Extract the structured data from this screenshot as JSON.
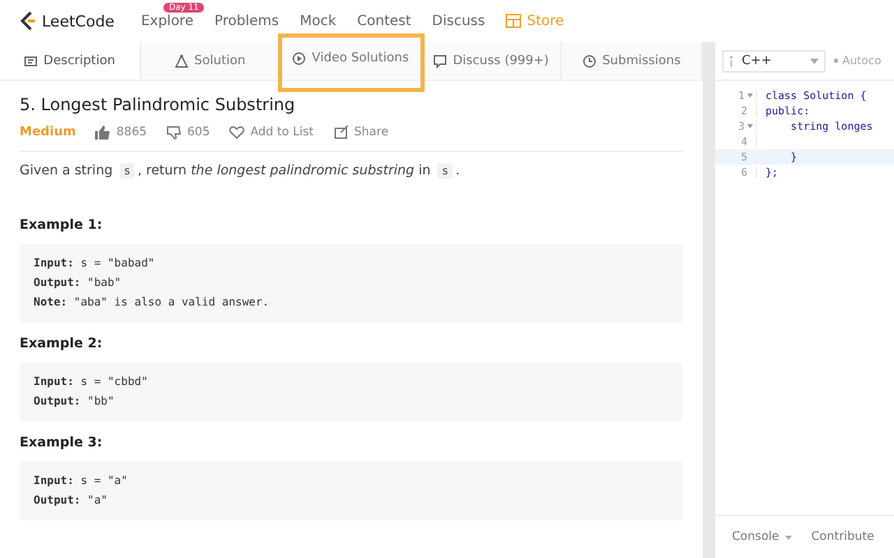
{
  "nav": {
    "logo": "LeetCode",
    "items": [
      {
        "label": "Explore",
        "badge": "Day 11",
        "kind": "plain"
      },
      {
        "label": "Problems",
        "kind": "plain"
      },
      {
        "label": "Mock",
        "kind": "plain"
      },
      {
        "label": "Contest",
        "kind": "plain"
      },
      {
        "label": "Discuss",
        "kind": "plain"
      },
      {
        "label": "Store",
        "kind": "store"
      }
    ]
  },
  "tabs": [
    {
      "label": "Description",
      "selected": true,
      "highlighted": false
    },
    {
      "label": "Solution",
      "selected": false,
      "highlighted": false
    },
    {
      "label": "Video Solutions",
      "selected": false,
      "highlighted": true
    },
    {
      "label": "Discuss (999+)",
      "selected": false,
      "highlighted": false
    },
    {
      "label": "Submissions",
      "selected": false,
      "highlighted": false
    }
  ],
  "problem": {
    "title": "5. Longest Palindromic Substring",
    "difficulty": "Medium",
    "likes": "8865",
    "dislikes": "605",
    "add_to_list": "Add to List",
    "share": "Share",
    "statement": [
      {
        "kind": "text",
        "text": "Given a string "
      },
      {
        "kind": "code",
        "text": "s"
      },
      {
        "kind": "text",
        "text": ", return "
      },
      {
        "kind": "italic",
        "text": "the longest palindromic substring"
      },
      {
        "kind": "text",
        "text": " in "
      },
      {
        "kind": "code",
        "text": "s"
      },
      {
        "kind": "text",
        "text": "."
      }
    ],
    "examples": [
      {
        "title": "Example 1:",
        "lines": [
          "**Input:** s = \"babad\"",
          "**Output:** \"bab\"",
          "**Note:** \"aba\" is also a valid answer."
        ]
      },
      {
        "title": "Example 2:",
        "lines": [
          "**Input:** s = \"cbbd\"",
          "**Output:** \"bb\""
        ]
      },
      {
        "title": "Example 3:",
        "lines": [
          "**Input:** s = \"a\"",
          "**Output:** \"a\""
        ]
      }
    ]
  },
  "editor": {
    "language": "C++",
    "autocomplete": "Autoco",
    "lines": [
      {
        "number": "1",
        "foldable": true,
        "active": false,
        "code": "class Solution {"
      },
      {
        "number": "2",
        "foldable": false,
        "active": false,
        "code": "public:"
      },
      {
        "number": "3",
        "foldable": true,
        "active": false,
        "code": "    string longes"
      },
      {
        "number": "4",
        "foldable": false,
        "active": false
      },
      {
        "number": "5",
        "foldable": false,
        "active": true,
        "code": "    }"
      },
      {
        "number": "6",
        "foldable": false,
        "active": false,
        "code": "};"
      }
    ],
    "footer": [
      "Console",
      "Contribute"
    ]
  }
}
